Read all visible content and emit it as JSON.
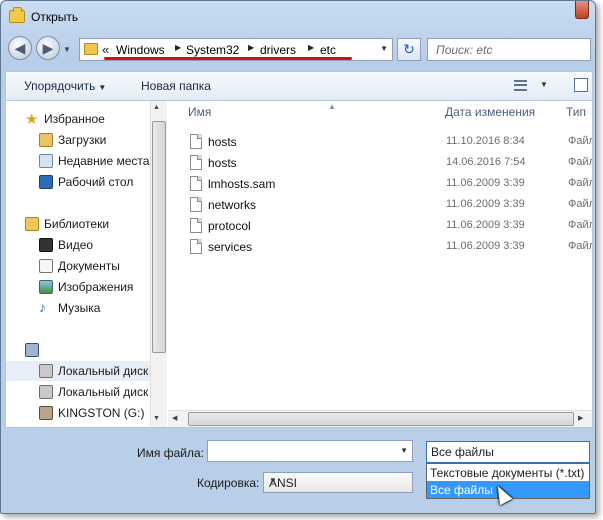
{
  "window": {
    "title": "Открыть"
  },
  "navbar": {
    "back_glyph": "◀",
    "forward_glyph": "▶",
    "breadcrumb_lead": "«",
    "breadcrumb": [
      "Windows",
      "System32",
      "drivers",
      "etc"
    ],
    "search_placeholder": "Поиск: etc",
    "annotation_color": "#d40f0f"
  },
  "toolbar": {
    "organize_label": "Упорядочить",
    "new_folder_label": "Новая папка"
  },
  "nav_pane": {
    "favorites_header": "Избранное",
    "favorites": [
      "Загрузки",
      "Недавние места",
      "Рабочий стол"
    ],
    "libraries_header": "Библиотеки",
    "libraries": [
      "Видео",
      "Документы",
      "Изображения",
      "Музыка"
    ],
    "computer_items": [
      "Локальный диск",
      "Локальный диск",
      "KINGSTON (G:)"
    ]
  },
  "columns": {
    "name": "Имя",
    "date": "Дата изменения",
    "type": "Тип"
  },
  "files": [
    {
      "name": "hosts",
      "date": "11.10.2016 8:34",
      "type": "Файл"
    },
    {
      "name": "hosts",
      "date": "14.06.2016 7:54",
      "type": "Файл"
    },
    {
      "name": "lmhosts.sam",
      "date": "11.06.2009 3:39",
      "type": "Файл"
    },
    {
      "name": "networks",
      "date": "11.06.2009 3:39",
      "type": "Файл"
    },
    {
      "name": "protocol",
      "date": "11.06.2009 3:39",
      "type": "Файл"
    },
    {
      "name": "services",
      "date": "11.06.2009 3:39",
      "type": "Файл"
    }
  ],
  "bottom": {
    "filename_label": "Имя файла:",
    "filename_value": "",
    "filetype_value": "Все файлы",
    "filetype_options": [
      "Текстовые документы (*.txt)",
      "Все файлы"
    ],
    "encoding_label": "Кодировка:",
    "encoding_value": "ANSI"
  }
}
